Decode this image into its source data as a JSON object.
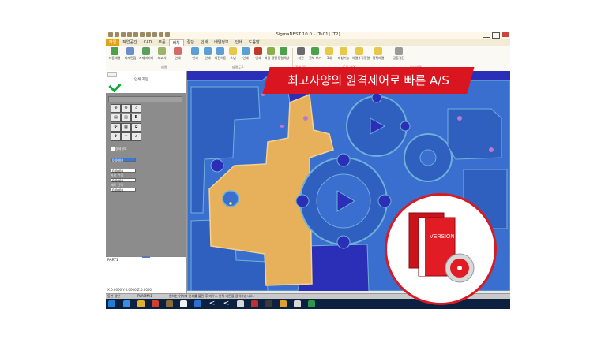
{
  "window": {
    "title": "SigmaNEST 10.0 -   [Tu01] [T2]"
  },
  "menu": {
    "file": "파일",
    "items": [
      "작업공간",
      "CAD",
      "부품",
      "배치",
      "절단",
      "인쇄",
      "배열정보",
      "인쇄",
      "도움말"
    ],
    "active_index": 3
  },
  "ribbon": {
    "buttons": [
      "자동배열",
      "자재편집",
      "자재리미터",
      "보고서",
      "인쇄",
      "인쇄",
      "인쇄",
      "회전이동",
      "스냅",
      "인쇄",
      "인쇄",
      "파일 정렬",
      "정렬해상",
      "회전",
      "전체 보기",
      "3배",
      "대칭기능",
      "배열수직정렬",
      "정적배열",
      "공통절단"
    ],
    "groups": [
      "배열",
      "배열도구",
      "잔여절단",
      "도움 배열",
      "인쇄배열"
    ]
  },
  "left_panel": {
    "top_label": "인쇄 자동",
    "check_label": "상세정보",
    "fields": [
      {
        "label": "",
        "value": "0.0000",
        "selected": true
      },
      {
        "label": "",
        "value": "0.0000",
        "selected": false
      },
      {
        "label": "가로 간격",
        "value": "0.0000",
        "selected": false
      },
      {
        "label": "세로 간격",
        "value": "0.0000",
        "selected": false
      }
    ],
    "toolbar_letter": "B",
    "bottom_label": "PART1"
  },
  "status": {
    "coord": "X:0.0000,Y:0.0000,Z:0.0000",
    "mode": "동판 절단",
    "machine": "PLASMA1",
    "hint": "원하는 위치에 인쇄를 불린 후 마우스 왼쪽 버튼을 클릭하십시오."
  },
  "banner": {
    "text": "최고사양의 원격제어로 빠른 A/S"
  },
  "product": {
    "version_text": "VERSION 10"
  },
  "colors": {
    "canvas_bg": "#2b2fb8",
    "sheet_blue": "#3a6fd0",
    "part_tan": "#e6b15a",
    "banner_red": "#d91620",
    "file_tab": "#e0a21b"
  }
}
